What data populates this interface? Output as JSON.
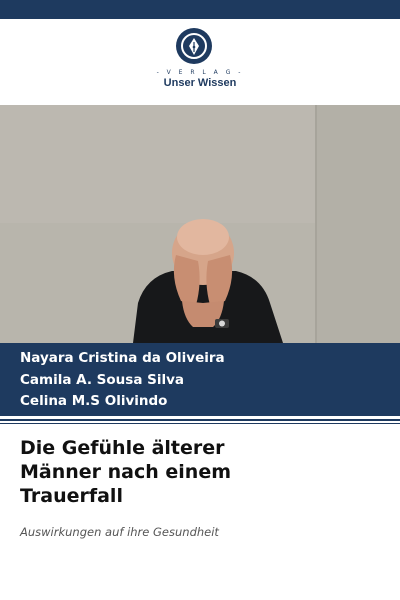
{
  "publisher": {
    "verlag_label": "- V E R L A G -",
    "name": "Unser Wissen"
  },
  "authors": [
    "Nayara Cristina da Oliveira",
    "Camila A. Sousa Silva",
    "Celina M.S Olivindo"
  ],
  "book": {
    "title": "Die Gefühle älterer\nMänner nach einem\nTrauerfall",
    "subtitle": "Auswirkungen auf ihre Gesundheit"
  },
  "colors": {
    "brand_navy": "#1e3a5f",
    "background": "#ffffff"
  },
  "cover_image": "elderly man in black shirt holding his head in his hands against a grey wall"
}
